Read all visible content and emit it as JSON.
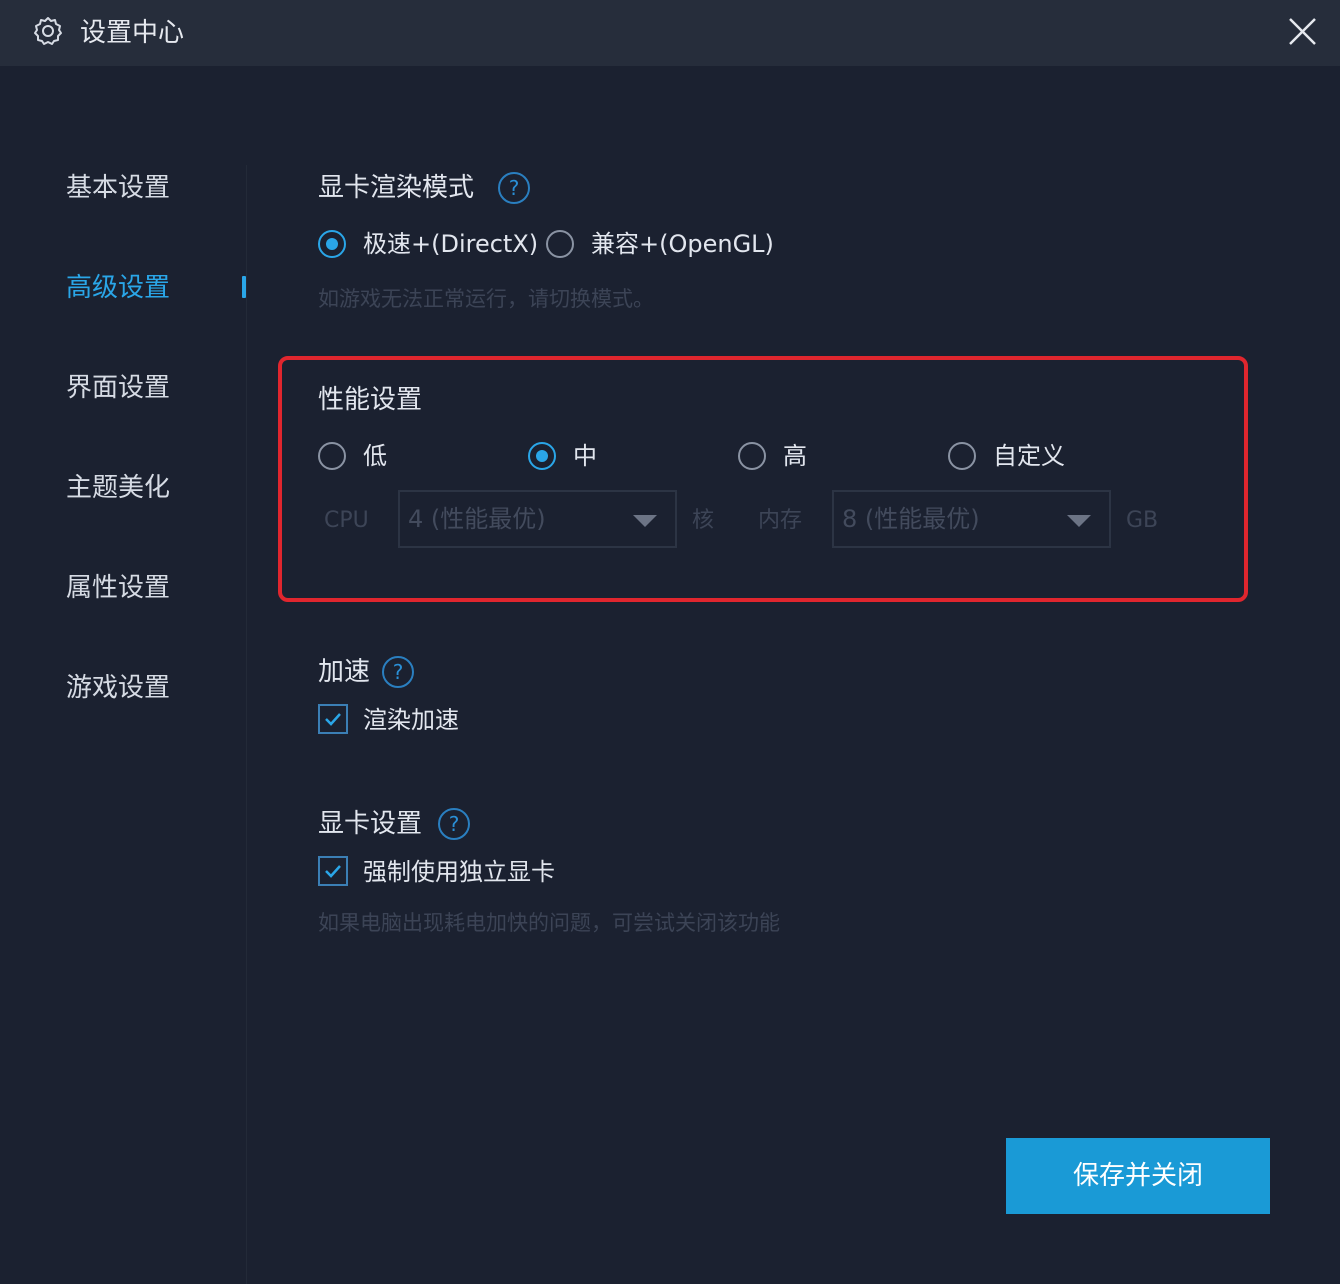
{
  "window": {
    "title": "设置中心",
    "title_icon": "gear-icon",
    "close_icon": "close-icon"
  },
  "sidebar": {
    "items": [
      {
        "label": "基本设置",
        "active": false
      },
      {
        "label": "高级设置",
        "active": true
      },
      {
        "label": "界面设置",
        "active": false
      },
      {
        "label": "主题美化",
        "active": false
      },
      {
        "label": "属性设置",
        "active": false
      },
      {
        "label": "游戏设置",
        "active": false
      }
    ]
  },
  "render_mode": {
    "title": "显卡渲染模式",
    "help": "?",
    "options": [
      {
        "label": "极速+(DirectX)",
        "selected": true
      },
      {
        "label": "兼容+(OpenGL)",
        "selected": false
      }
    ],
    "hint": "如游戏无法正常运行，请切换模式。"
  },
  "performance": {
    "title": "性能设置",
    "options": [
      {
        "label": "低",
        "selected": false
      },
      {
        "label": "中",
        "selected": true
      },
      {
        "label": "高",
        "selected": false
      },
      {
        "label": "自定义",
        "selected": false
      }
    ],
    "cpu_label": "CPU",
    "cpu_value": "4 (性能最优)",
    "cpu_unit": "核",
    "mem_label": "内存",
    "mem_value": "8 (性能最优)",
    "mem_unit": "GB"
  },
  "acceleration": {
    "title": "加速",
    "help": "?",
    "checkbox_label": "渲染加速",
    "checked": true
  },
  "gpu": {
    "title": "显卡设置",
    "help": "?",
    "checkbox_label": "强制使用独立显卡",
    "checked": true,
    "hint": "如果电脑出现耗电加快的问题，可尝试关闭该功能"
  },
  "footer": {
    "save_label": "保存并关闭"
  },
  "colors": {
    "accent": "#2aa6e8",
    "highlight": "#e0262e",
    "button": "#1a9ad6"
  }
}
